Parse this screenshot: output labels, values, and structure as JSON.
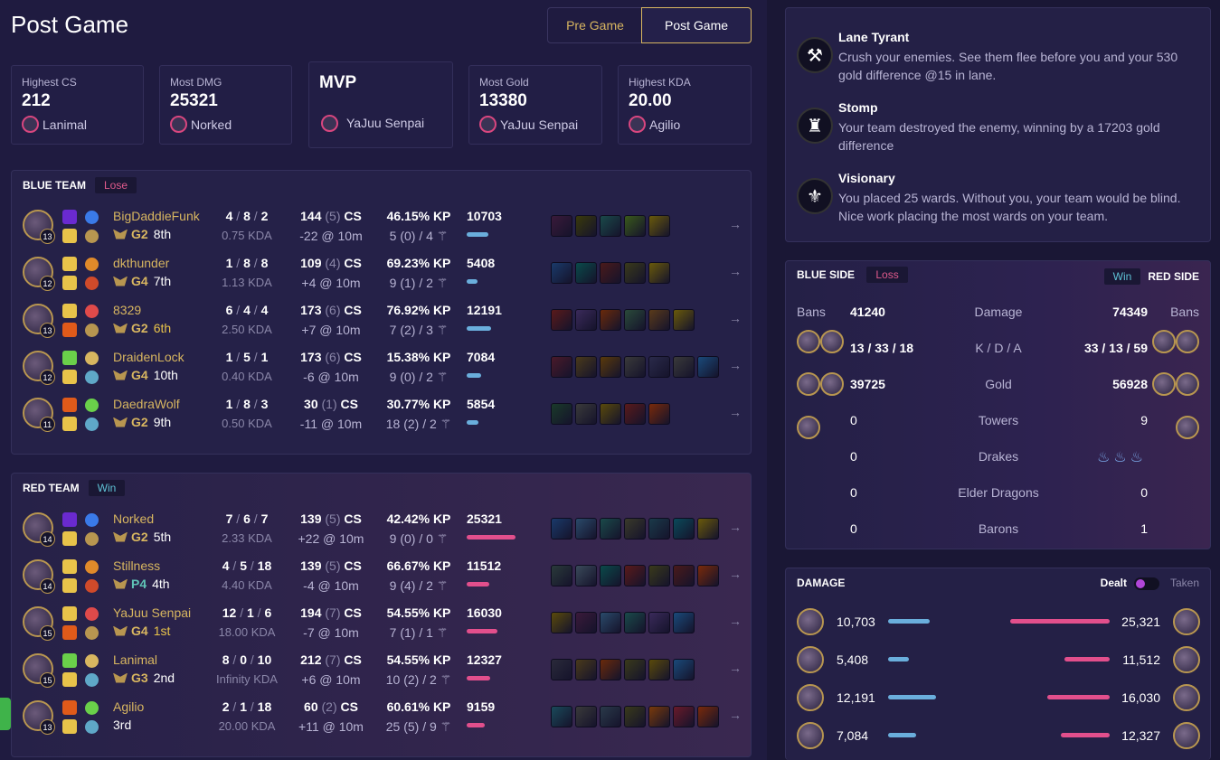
{
  "page": {
    "title": "Post Game"
  },
  "tabs": {
    "pre": "Pre Game",
    "post": "Post Game"
  },
  "stats": [
    {
      "label": "Highest CS",
      "value": "212",
      "player": "Lanimal"
    },
    {
      "label": "Most DMG",
      "value": "25321",
      "player": "Norked"
    },
    {
      "label": "",
      "value": "MVP",
      "player": "YaJuu Senpai"
    },
    {
      "label": "Most Gold",
      "value": "13380",
      "player": "YaJuu Senpai"
    },
    {
      "label": "Highest KDA",
      "value": "20.00",
      "player": "Agilio"
    }
  ],
  "blue": {
    "title": "BLUE TEAM",
    "result": "Lose",
    "players": [
      {
        "name": "BigDaddieFunk",
        "level": "13",
        "rank": "G2",
        "place": "8th",
        "k": "4",
        "d": "8",
        "a": "2",
        "kda": "0.75 KDA",
        "cs": "144",
        "csm": "(5)",
        "cs_unit": "CS",
        "csd": "-22 @ 10m",
        "kp": "46.15% KP",
        "wards": "5 (0) / 4",
        "dmg": "10703",
        "dmg_frac": 0.42,
        "items": [
          "#3a1a3a",
          "#3a3a0a",
          "#1a4a4a",
          "#3a5a1a",
          "#6a5a0a"
        ]
      },
      {
        "name": "dkthunder",
        "level": "12",
        "rank": "G4",
        "place": "7th",
        "k": "1",
        "d": "8",
        "a": "8",
        "kda": "1.13 KDA",
        "cs": "109",
        "csm": "(4)",
        "cs_unit": "CS",
        "csd": "+4 @ 10m",
        "kp": "69.23% KP",
        "wards": "9 (1) / 2",
        "dmg": "5408",
        "dmg_frac": 0.21,
        "items": [
          "#1a3a6a",
          "#0a4a4a",
          "#4a1a1a",
          "#3a3a1a",
          "#6a5a0a"
        ]
      },
      {
        "name": "8329",
        "level": "13",
        "rank": "G2",
        "place": "6th",
        "k": "6",
        "d": "4",
        "a": "4",
        "kda": "2.50 KDA",
        "cs": "173",
        "csm": "(6)",
        "cs_unit": "CS",
        "csd": "+7 @ 10m",
        "kp": "76.92% KP",
        "wards": "7 (2) / 3",
        "dmg": "12191",
        "dmg_frac": 0.48,
        "items": [
          "#5a1a1a",
          "#3a2a5a",
          "#6a2a0a",
          "#2a4a3a",
          "#5a3a1a",
          "#6a5a0a"
        ]
      },
      {
        "name": "DraidenLock",
        "level": "12",
        "rank": "G4",
        "place": "10th",
        "k": "1",
        "d": "5",
        "a": "1",
        "kda": "0.40 KDA",
        "cs": "173",
        "csm": "(6)",
        "cs_unit": "CS",
        "csd": "-6 @ 10m",
        "kp": "15.38% KP",
        "wards": "9 (0) / 2",
        "dmg": "7084",
        "dmg_frac": 0.28,
        "items": [
          "#4a1a2a",
          "#4a3a1a",
          "#5a3a0a",
          "#3a3a3a",
          "#2a2a4a",
          "#3a3a3a",
          "#1a4a7a"
        ]
      },
      {
        "name": "DaedraWolf",
        "level": "11",
        "rank": "G2",
        "place": "9th",
        "k": "1",
        "d": "8",
        "a": "3",
        "kda": "0.50 KDA",
        "cs": "30",
        "csm": "(1)",
        "cs_unit": "CS",
        "csd": "-11 @ 10m",
        "kp": "30.77% KP",
        "wards": "18 (2) / 2",
        "dmg": "5854",
        "dmg_frac": 0.23,
        "items": [
          "#1a3a2a",
          "#3a3a3a",
          "#5a4a0a",
          "#5a1a1a",
          "#7a2a0a"
        ]
      }
    ]
  },
  "red": {
    "title": "RED TEAM",
    "result": "Win",
    "players": [
      {
        "name": "Norked",
        "level": "14",
        "rank": "G2",
        "place": "5th",
        "k": "7",
        "d": "6",
        "a": "7",
        "kda": "2.33 KDA",
        "cs": "139",
        "csm": "(5)",
        "cs_unit": "CS",
        "csd": "+22 @ 10m",
        "kp": "42.42% KP",
        "wards": "9 (0) / 0",
        "dmg": "25321",
        "dmg_frac": 0.96,
        "items": [
          "#1a3a6a",
          "#2a4a6a",
          "#1a4a4a",
          "#3a3a2a",
          "#1a3a4a",
          "#0a4a5a",
          "#6a5a0a"
        ]
      },
      {
        "name": "Stillness",
        "level": "14",
        "rank": "P4",
        "place": "4th",
        "k": "4",
        "d": "5",
        "a": "18",
        "kda": "4.40 KDA",
        "cs": "139",
        "csm": "(5)",
        "cs_unit": "CS",
        "csd": "-4 @ 10m",
        "kp": "66.67% KP",
        "wards": "9 (4) / 2",
        "dmg": "11512",
        "dmg_frac": 0.44,
        "items": [
          "#2a3a3a",
          "#3a4a5a",
          "#0a4a4a",
          "#5a1a1a",
          "#3a3a1a",
          "#4a1a1a",
          "#7a2a0a"
        ]
      },
      {
        "name": "YaJuu Senpai",
        "level": "15",
        "rank": "G4",
        "place": "1st",
        "k": "12",
        "d": "1",
        "a": "6",
        "kda": "18.00 KDA",
        "cs": "194",
        "csm": "(7)",
        "cs_unit": "CS",
        "csd": "-7 @ 10m",
        "kp": "54.55% KP",
        "wards": "7 (1) / 1",
        "dmg": "16030",
        "dmg_frac": 0.61,
        "items": [
          "#5a4a0a",
          "#3a1a3a",
          "#2a4a6a",
          "#1a4a4a",
          "#3a2a5a",
          "#1a4a7a"
        ]
      },
      {
        "name": "Lanimal",
        "level": "15",
        "rank": "G3",
        "place": "2nd",
        "k": "8",
        "d": "0",
        "a": "10",
        "kda": "Infinity KDA",
        "cs": "212",
        "csm": "(7)",
        "cs_unit": "CS",
        "csd": "+6 @ 10m",
        "kp": "54.55% KP",
        "wards": "10 (2) / 2",
        "dmg": "12327",
        "dmg_frac": 0.47,
        "items": [
          "#2a2a3a",
          "#4a3a1a",
          "#6a2a0a",
          "#3a3a1a",
          "#5a4a0a",
          "#1a4a7a"
        ]
      },
      {
        "name": "Agilio",
        "level": "13",
        "rank": "",
        "place": "3rd",
        "k": "2",
        "d": "1",
        "a": "18",
        "kda": "20.00 KDA",
        "cs": "60",
        "csm": "(2)",
        "cs_unit": "CS",
        "csd": "+11 @ 10m",
        "kp": "60.61% KP",
        "wards": "25 (5) / 9",
        "dmg": "9159",
        "dmg_frac": 0.35,
        "items": [
          "#1a4a5a",
          "#3a3a3a",
          "#2a3a4a",
          "#3a3a1a",
          "#7a3a0a",
          "#6a1a2a",
          "#7a2a0a"
        ]
      }
    ]
  },
  "badges": [
    {
      "icon": "lane-tyrant-icon",
      "glyph": "⚒",
      "title": "Lane Tyrant",
      "desc": "Crush your enemies. See them flee before you and your 530 gold difference @15 in lane."
    },
    {
      "icon": "stomp-icon",
      "glyph": "♜",
      "title": "Stomp",
      "desc": "Your team destroyed the enemy, winning by a 17203 gold difference"
    },
    {
      "icon": "visionary-icon",
      "glyph": "⚜",
      "title": "Visionary",
      "desc": "You placed 25 wards. Without you, your team would be blind. Nice work placing the most wards on your team."
    }
  ],
  "compare": {
    "blue_label": "BLUE SIDE",
    "blue_result": "Loss",
    "red_label": "RED SIDE",
    "red_result": "Win",
    "bans_label": "Bans",
    "rows": [
      {
        "label": "Damage",
        "blue": "41240",
        "red": "74349"
      },
      {
        "label": "K / D / A",
        "blue": "13 / 33 / 18",
        "red": "33 / 13 / 59"
      },
      {
        "label": "Gold",
        "blue": "39725",
        "red": "56928"
      },
      {
        "label": "Towers",
        "blue": "0",
        "red": "9"
      },
      {
        "label": "Drakes",
        "blue": "0",
        "red": ""
      },
      {
        "label": "Elder Dragons",
        "blue": "0",
        "red": "0"
      },
      {
        "label": "Barons",
        "blue": "0",
        "red": "1"
      }
    ]
  },
  "damage": {
    "title": "DAMAGE",
    "dealt": "Dealt",
    "taken": "Taken",
    "rows": [
      {
        "left": "10,703",
        "left_frac": 0.42,
        "right": "25,321",
        "right_frac": 1.0
      },
      {
        "left": "5,408",
        "left_frac": 0.21,
        "right": "11,512",
        "right_frac": 0.45
      },
      {
        "left": "12,191",
        "left_frac": 0.48,
        "right": "16,030",
        "right_frac": 0.63
      },
      {
        "left": "7,084",
        "left_frac": 0.28,
        "right": "12,327",
        "right_frac": 0.49
      }
    ]
  }
}
